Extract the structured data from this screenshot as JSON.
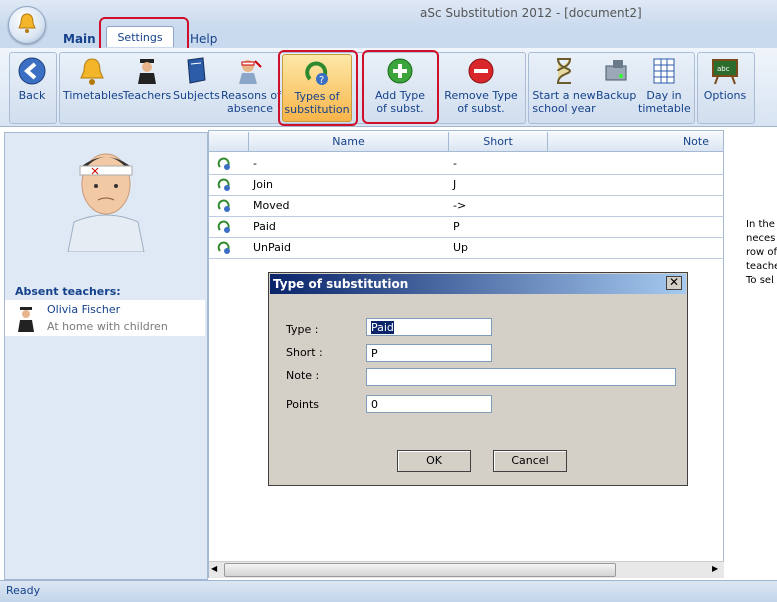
{
  "window": {
    "title": "aSc Substitution 2012  - [document2]"
  },
  "tabs": {
    "main": "Main",
    "settings": "Settings",
    "help": "Help"
  },
  "ribbon": {
    "back": "Back",
    "timetables": "Timetables",
    "teachers": "Teachers",
    "subjects": "Subjects",
    "reasons": [
      "Reasons of",
      "absence"
    ],
    "types": [
      "Types of",
      "substitution"
    ],
    "add_type": [
      "Add Type",
      "of subst."
    ],
    "remove_type": [
      "Remove Type",
      "of subst."
    ],
    "new_year": [
      "Start a new",
      "school year"
    ],
    "backup": "Backup",
    "day": [
      "Day in",
      "timetable"
    ],
    "options": "Options"
  },
  "left": {
    "absent_title": "Absent teachers:",
    "teacher_name": "Olivia Fischer",
    "teacher_reason": "At home with children"
  },
  "grid": {
    "headers": {
      "name": "Name",
      "short": "Short",
      "note": "Note"
    },
    "rows": [
      {
        "name": "-",
        "short": "-"
      },
      {
        "name": "Join",
        "short": "J"
      },
      {
        "name": "Moved",
        "short": "->"
      },
      {
        "name": "Paid",
        "short": "P"
      },
      {
        "name": "UnPaid",
        "short": "Up"
      }
    ]
  },
  "right_info": "In the l\nneces\nrow of\nteache\nTo sel",
  "dialog": {
    "title": "Type of substitution",
    "close": "✕",
    "type_label": "Type :",
    "type_value": "Paid",
    "short_label": "Short :",
    "short_value": "P",
    "note_label": "Note :",
    "note_value": "",
    "points_label": "Points",
    "points_value": "0",
    "ok": "OK",
    "cancel": "Cancel"
  },
  "status": "Ready",
  "colors": {
    "accent": "#15428b",
    "highlight": "#d0102b",
    "active": "#f8b44a"
  }
}
